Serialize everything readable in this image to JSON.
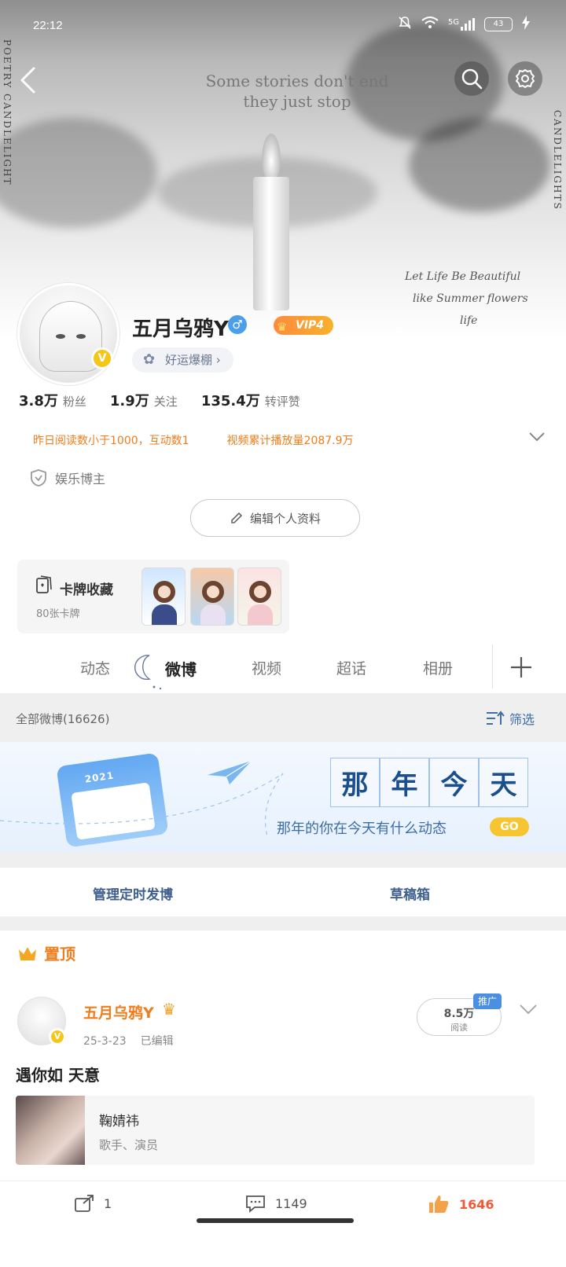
{
  "status_bar": {
    "time": "22:12",
    "network": "5G",
    "battery": "43"
  },
  "banner": {
    "quote_line1": "Some stories don't end",
    "quote_line2": "they just stop",
    "script_line1": "Let Life Be Beautiful",
    "script_line2": "like Summer flowers",
    "script_line3": "life",
    "side_text_left": "POETRY CANDLELIGHT",
    "side_text_right": "CANDLELIGHTS"
  },
  "profile": {
    "name": "五月乌鸦Y",
    "gender_symbol": "♂",
    "vip_label": "VIP4",
    "verified_symbol": "V",
    "lucky_tag": "好运爆棚",
    "stats": [
      {
        "num": "3.8万",
        "label": "粉丝"
      },
      {
        "num": "1.9万",
        "label": "关注"
      },
      {
        "num": "135.4万",
        "label": "转评赞"
      }
    ],
    "notice_1": "昨日阅读数小于1000，互动数1",
    "notice_2": "视频累计播放量2087.9万",
    "role": "娱乐博主",
    "edit_button": "编辑个人资料"
  },
  "cards": {
    "title": "卡牌收藏",
    "count": "80张卡牌"
  },
  "tabs": [
    "动态",
    "微博",
    "视频",
    "超话",
    "相册"
  ],
  "active_tab": "微博",
  "filter_bar": {
    "count": "全部微博(16626)",
    "filter_label": "筛选"
  },
  "memory_banner": {
    "year": "2021",
    "chars": [
      "那",
      "年",
      "今",
      "天"
    ],
    "caption": "那年的你在今天有什么动态",
    "go": "GO"
  },
  "actions": {
    "scheduled": "管理定时发博",
    "drafts": "草稿箱"
  },
  "post": {
    "pinned_label": "置顶",
    "author": "五月乌鸦Y",
    "date": "25-3-23",
    "edited": "已编辑",
    "reads_num": "8.5万",
    "reads_label": "阅读",
    "promo": "推广",
    "text": "遇你如  天意",
    "card_name": "鞠婧祎",
    "card_desc": "歌手、演员",
    "reposts": "1",
    "comments": "1149",
    "likes": "1646"
  },
  "colors": {
    "accent_orange": "#ef7d1b",
    "link_blue": "#3d6fa6",
    "vip_gold": "#f5b22c"
  }
}
